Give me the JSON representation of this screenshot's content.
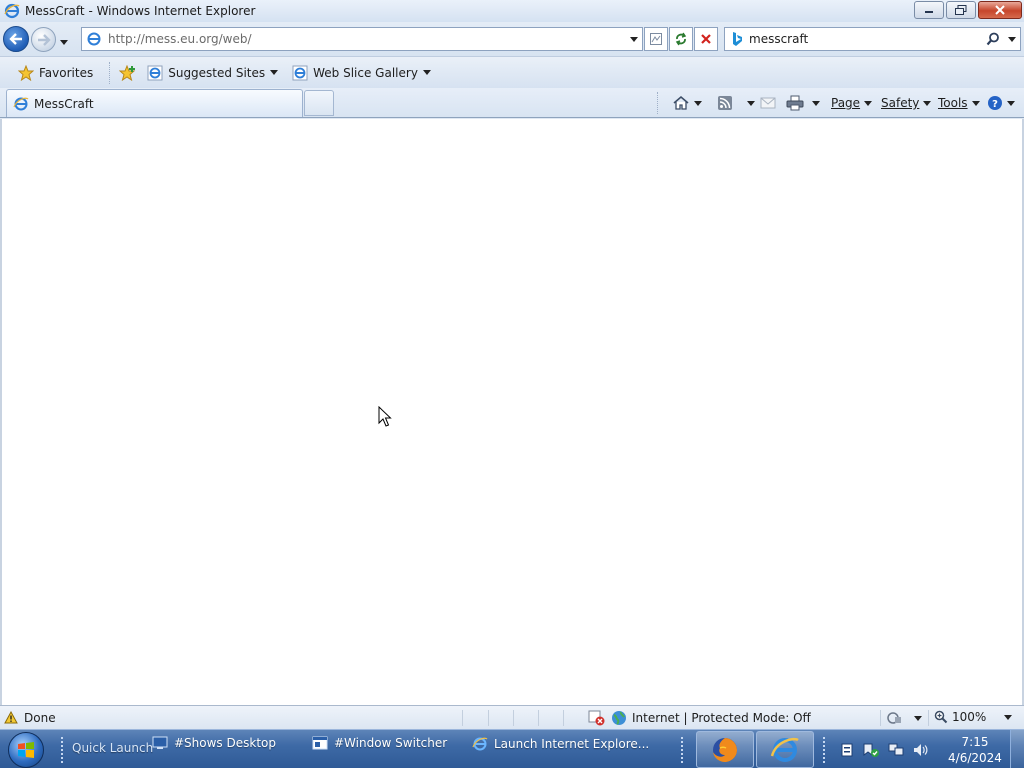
{
  "window": {
    "title": "MessCraft - Windows Internet Explorer"
  },
  "address_bar": {
    "url": "http://mess.eu.org/web/"
  },
  "search": {
    "value": "messcraft"
  },
  "favorites_bar": {
    "favorites_label": "Favorites",
    "items": [
      {
        "label": "Suggested Sites"
      },
      {
        "label": "Web Slice Gallery"
      }
    ]
  },
  "tabs": [
    {
      "label": "MessCraft"
    }
  ],
  "command_bar": {
    "page_label": "Page",
    "safety_label": "Safety",
    "tools_label": "Tools"
  },
  "status_bar": {
    "status_text": "Done",
    "zone_text": "Internet | Protected Mode: Off",
    "zoom_text": "100%"
  },
  "taskbar": {
    "quick_launch_label": "Quick Launch",
    "items": [
      {
        "label": "#Shows Desktop"
      },
      {
        "label": "#Window Switcher"
      },
      {
        "label": "Launch Internet Explore..."
      }
    ],
    "clock_time": "7:15",
    "clock_date": "4/6/2024"
  },
  "colors": {
    "chrome_bg": "#dfe8f3",
    "content_bg": "#ffffff",
    "taskbar": "#3e6aa6"
  }
}
